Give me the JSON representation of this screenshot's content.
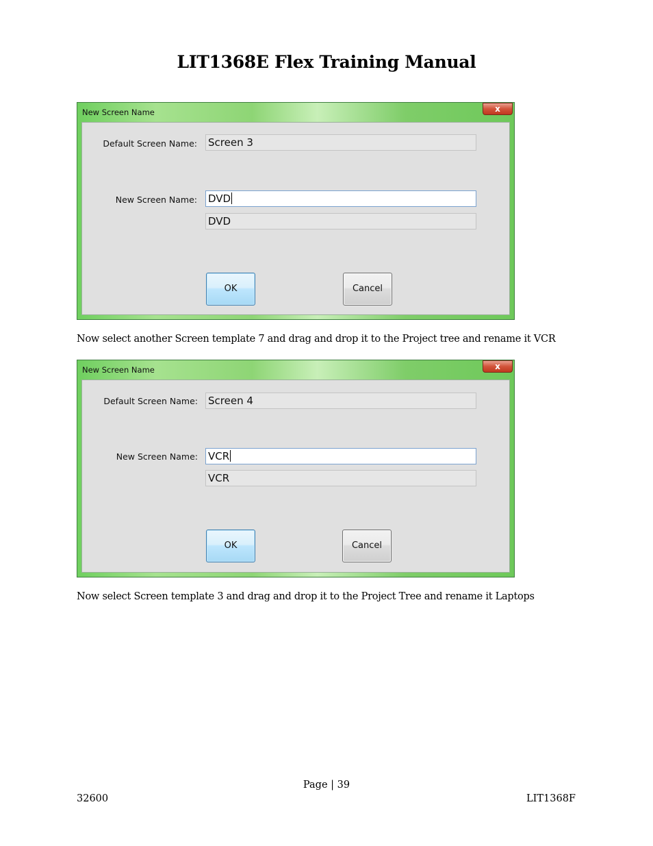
{
  "document": {
    "title": "LIT1368E Flex Training Manual",
    "paragraphs": [
      "Now select another Screen template 7 and drag and drop it to the Project tree and rename it VCR",
      "Now select Screen template 3 and drag and drop it to the Project Tree and rename it Laptops"
    ],
    "footer": {
      "page_label": "Page | 39",
      "left_code": "32600",
      "right_code": "LIT1368F"
    }
  },
  "dialogs": [
    {
      "title": "New Screen Name",
      "close_label": "x",
      "default_label": "Default Screen Name:",
      "default_value": "Screen 3",
      "new_label": "New Screen Name:",
      "new_value": "DVD",
      "preview_value": "DVD",
      "ok_label": "OK",
      "cancel_label": "Cancel"
    },
    {
      "title": "New Screen Name",
      "close_label": "x",
      "default_label": "Default Screen Name:",
      "default_value": "Screen 4",
      "new_label": "New Screen Name:",
      "new_value": "VCR",
      "preview_value": "VCR",
      "ok_label": "OK",
      "cancel_label": "Cancel"
    }
  ],
  "colors": {
    "titlebar_green": "#8ed575",
    "ok_border": "#3c7fb1",
    "close_red": "#d2543a"
  }
}
